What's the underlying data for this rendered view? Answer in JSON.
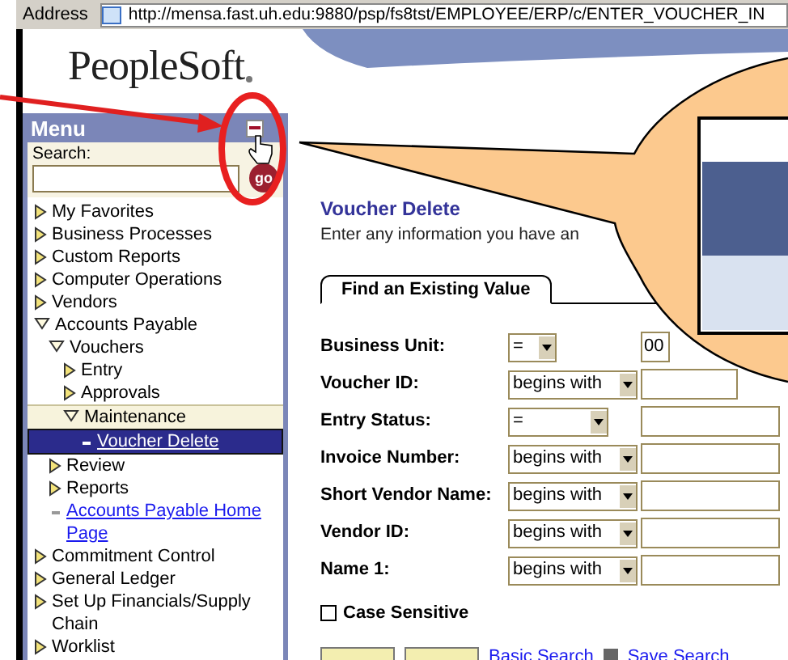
{
  "address_bar": {
    "label": "Address",
    "url": "http://mensa.fast.uh.edu:9880/psp/fs8tst/EMPLOYEE/ERP/c/ENTER_VOUCHER_IN"
  },
  "logo": "PeopleSoft",
  "menu": {
    "title": "Menu",
    "search_label": "Search:",
    "go_button": "go",
    "items": [
      {
        "label": "My Favorites",
        "kind": "folder",
        "expanded": false,
        "selected": false
      },
      {
        "label": "Business Processes",
        "kind": "folder",
        "expanded": false,
        "selected": false
      },
      {
        "label": "Custom Reports",
        "kind": "folder",
        "expanded": false,
        "selected": false
      },
      {
        "label": "Computer Operations",
        "kind": "folder",
        "expanded": false,
        "selected": false
      },
      {
        "label": "Vendors",
        "kind": "folder",
        "expanded": false,
        "selected": false
      },
      {
        "label": "Accounts Payable",
        "kind": "folder",
        "expanded": true,
        "selected": false,
        "children": [
          {
            "label": "Vouchers",
            "kind": "folder",
            "expanded": true,
            "selected": false,
            "children": [
              {
                "label": "Entry",
                "kind": "folder",
                "expanded": false,
                "selected": false
              },
              {
                "label": "Approvals",
                "kind": "folder",
                "expanded": false,
                "selected": false
              },
              {
                "label": "Maintenance",
                "kind": "folder",
                "expanded": true,
                "selected": false,
                "children": [
                  {
                    "label": "Voucher Delete",
                    "kind": "link",
                    "selected": true
                  }
                ]
              }
            ]
          },
          {
            "label": "Review",
            "kind": "folder",
            "expanded": false,
            "selected": false
          },
          {
            "label": "Reports",
            "kind": "folder",
            "expanded": false,
            "selected": false
          },
          {
            "label": "Accounts Payable Home Page",
            "kind": "link",
            "selected": false
          }
        ]
      },
      {
        "label": "Commitment Control",
        "kind": "folder",
        "expanded": false,
        "selected": false
      },
      {
        "label": "General Ledger",
        "kind": "folder",
        "expanded": false,
        "selected": false
      },
      {
        "label": "Set Up Financials/Supply Chain",
        "kind": "folder",
        "expanded": false,
        "selected": false
      },
      {
        "label": "Worklist",
        "kind": "folder",
        "expanded": false,
        "selected": false
      }
    ]
  },
  "page": {
    "title": "Voucher Delete",
    "instructions": "Enter any information you have an",
    "tabs": [
      {
        "label": "Find an Existing Value",
        "selected": true
      }
    ],
    "fields": [
      {
        "label": "Business Unit:",
        "operator": "=",
        "value": "00"
      },
      {
        "label": "Voucher ID:",
        "operator": "begins with"
      },
      {
        "label": "Entry Status:",
        "operator": "="
      },
      {
        "label": "Invoice Number:",
        "operator": "begins with"
      },
      {
        "label": "Short Vendor Name:",
        "operator": "begins with"
      },
      {
        "label": "Vendor ID:",
        "operator": "begins with"
      },
      {
        "label": "Name 1:",
        "operator": "begins with"
      }
    ],
    "case_sensitive": {
      "label": "Case Sensitive",
      "checked": false
    },
    "links": [
      "Basic Search",
      "Save Search"
    ]
  }
}
